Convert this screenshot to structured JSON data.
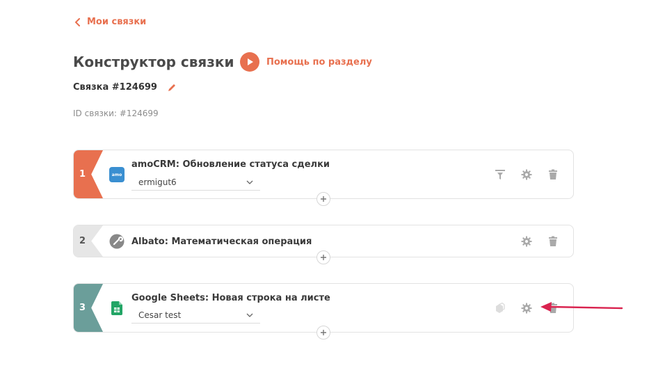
{
  "nav": {
    "back_label": "Мои связки"
  },
  "header": {
    "title": "Конструктор связки",
    "help_label": "Помощь по разделу",
    "bundle_name": "Связка #124699",
    "bundle_id_text": "ID связки: #124699"
  },
  "steps": [
    {
      "number": "1",
      "title": "amoCRM: Обновление статуса сделки",
      "account": "ermigut6",
      "icon_label": "amo"
    },
    {
      "number": "2",
      "title": "Albato: Математическая операция"
    },
    {
      "number": "3",
      "title": "Google Sheets: Новая строка на листе",
      "account": "Cesar test"
    }
  ],
  "colors": {
    "accent": "#e8704f",
    "step1": "#e8704f",
    "step2": "#e6e6e6",
    "step3": "#6b9e9a",
    "annotation_arrow": "#d9234f"
  }
}
